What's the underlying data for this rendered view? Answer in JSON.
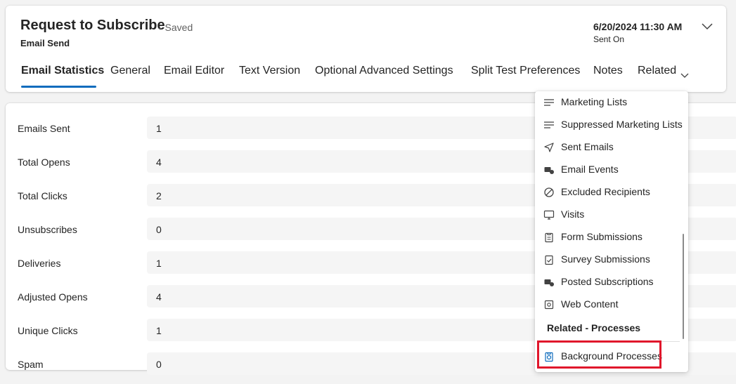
{
  "header": {
    "title": "Request to Subscribe",
    "saved_status": "- Saved",
    "entity_type": "Email Send",
    "datetime": "6/20/2024 11:30 AM",
    "datetime_label": "Sent On"
  },
  "tabs": [
    {
      "label": "Email Statistics",
      "active": true
    },
    {
      "label": "General"
    },
    {
      "label": "Email Editor"
    },
    {
      "label": "Text Version"
    },
    {
      "label": "Optional Advanced Settings"
    },
    {
      "label": "Split Test Preferences"
    },
    {
      "label": "Notes"
    },
    {
      "label": "Related"
    }
  ],
  "fields": [
    {
      "label": "Emails Sent",
      "value": "1"
    },
    {
      "label": "Total Opens",
      "value": "4"
    },
    {
      "label": "Total Clicks",
      "value": "2"
    },
    {
      "label": "Unsubscribes",
      "value": "0"
    },
    {
      "label": "Deliveries",
      "value": "1"
    },
    {
      "label": "Adjusted Opens",
      "value": "4"
    },
    {
      "label": "Unique Clicks",
      "value": "1"
    },
    {
      "label": "Spam",
      "value": "0"
    }
  ],
  "related_menu": {
    "items": [
      {
        "label": "Marketing Lists",
        "icon": "list-icon"
      },
      {
        "label": "Suppressed Marketing Lists",
        "icon": "list-icon"
      },
      {
        "label": "Sent Emails",
        "icon": "send-icon"
      },
      {
        "label": "Email Events",
        "icon": "email-events-icon"
      },
      {
        "label": "Excluded Recipients",
        "icon": "prohibited-icon"
      },
      {
        "label": "Visits",
        "icon": "desktop-icon"
      },
      {
        "label": "Form Submissions",
        "icon": "clipboard-icon"
      },
      {
        "label": "Survey Submissions",
        "icon": "clipboard-check-icon"
      },
      {
        "label": "Posted Subscriptions",
        "icon": "email-events-icon"
      },
      {
        "label": "Web Content",
        "icon": "web-content-icon"
      }
    ],
    "section_title": "Related - Processes",
    "process_items": [
      {
        "label": "Background Processes",
        "icon": "background-process-icon",
        "highlighted": true
      }
    ]
  },
  "colors": {
    "accent": "#0f6cbd",
    "highlight": "#e0162b"
  }
}
